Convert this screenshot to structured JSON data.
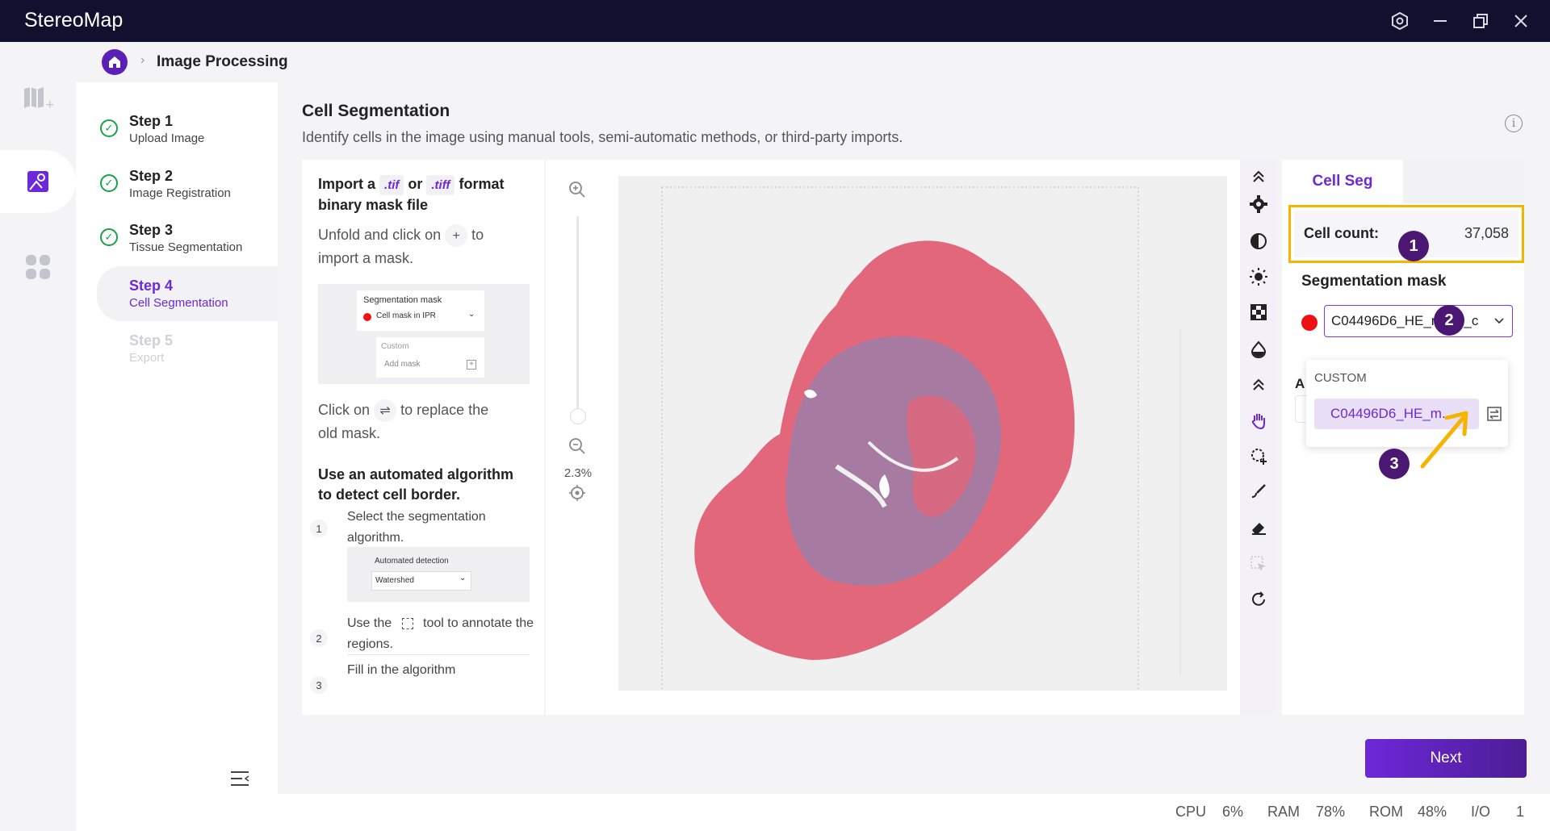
{
  "app": {
    "title": "StereoMap"
  },
  "breadcrumb": {
    "current": "Image Processing"
  },
  "steps": [
    {
      "title": "Step 1",
      "subtitle": "Upload Image",
      "state": "done"
    },
    {
      "title": "Step 2",
      "subtitle": "Image Registration",
      "state": "done"
    },
    {
      "title": "Step 3",
      "subtitle": "Tissue Segmentation",
      "state": "done"
    },
    {
      "title": "Step 4",
      "subtitle": "Cell Segmentation",
      "state": "active"
    },
    {
      "title": "Step 5",
      "subtitle": "Export",
      "state": "disabled"
    }
  ],
  "page": {
    "title": "Cell Segmentation",
    "description": "Identify cells in the image using manual tools, semi-automatic methods, or third-party imports."
  },
  "help": {
    "import_pre": "Import a",
    "import_tif": ".tif",
    "import_or": "or",
    "import_tiff": ".tiff",
    "import_post": "format",
    "import_line2": "binary mask file",
    "unfold_pre": "Unfold and click on",
    "unfold_btn": "+",
    "unfold_post": "to",
    "unfold_line2": "import a mask.",
    "mock1": {
      "title": "Segmentation mask",
      "select": "Cell mask in IPR",
      "custom": "Custom",
      "add": "Add mask"
    },
    "replace_pre": "Click on",
    "replace_btn": "⇌",
    "replace_post": "to replace the",
    "replace_line2": "old mask.",
    "auto_h1": "Use an automated algorithm",
    "auto_h2": "to detect cell border.",
    "list": [
      {
        "num": "1",
        "text": "Select the segmentation algorithm."
      },
      {
        "num": "2",
        "text_pre": "Use the",
        "text_post": "tool to annotate the regions."
      },
      {
        "num": "3",
        "text": "Fill in the algorithm"
      }
    ],
    "mock2": {
      "title": "Automated detection",
      "select": "Watershed"
    }
  },
  "zoom": {
    "level": "2.3%"
  },
  "right_panel": {
    "tab": "Cell Seg",
    "cell_count_label": "Cell count:",
    "cell_count_value": "37,058",
    "seg_mask_title": "Segmentation mask",
    "mask_value": "C04496D6_HE_mask_c",
    "dropdown_header": "CUSTOM",
    "dropdown_item": "C04496D6_HE_m...",
    "hidden_label": "A"
  },
  "badges": [
    "1",
    "2",
    "3"
  ],
  "next_button": "Next",
  "status": {
    "cpu_label": "CPU",
    "cpu": "6%",
    "ram_label": "RAM",
    "ram": "78%",
    "rom_label": "ROM",
    "rom": "48%",
    "io_label": "I/O",
    "io": "1"
  },
  "colors": {
    "accent": "#6d28d9",
    "highlight": "#f5b400",
    "badge": "#4a1772",
    "titlebar": "#12102f"
  }
}
